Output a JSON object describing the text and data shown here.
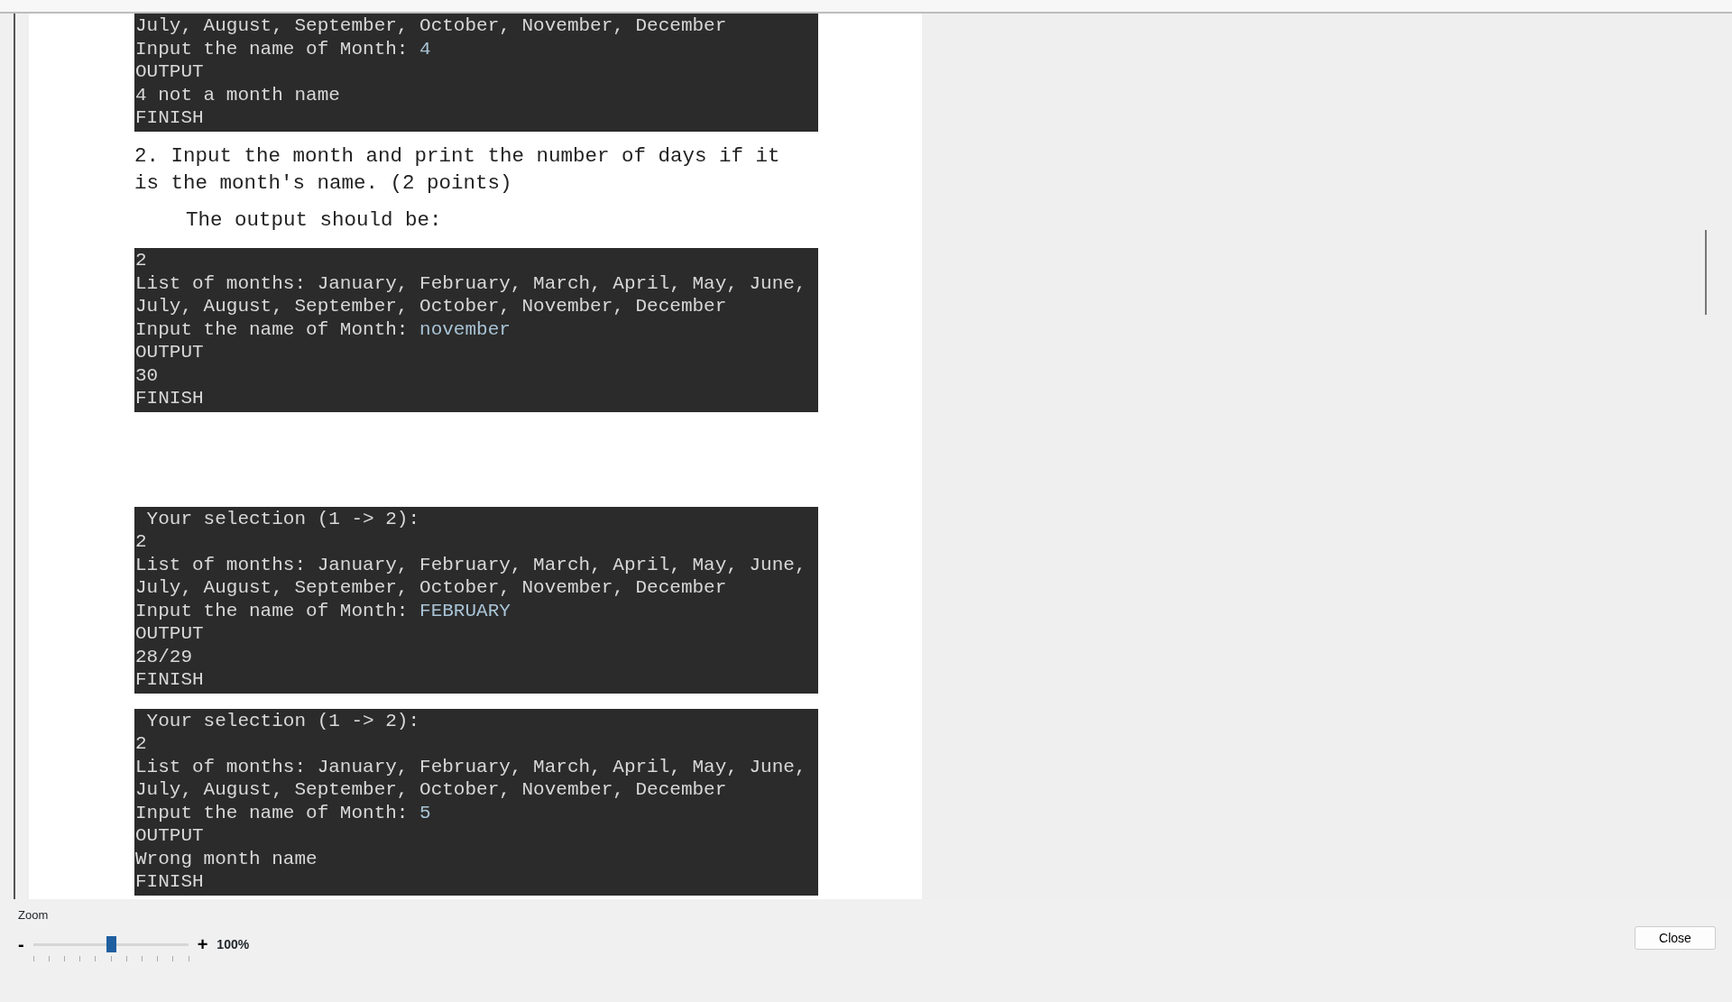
{
  "document": {
    "blocks": [
      {
        "kind": "console",
        "lines": [
          {
            "text": "July, August, September, October, November, December"
          },
          {
            "text": "Input the name of Month: ",
            "input": "4"
          },
          {
            "text": "OUTPUT"
          },
          {
            "text": "4 not a month name"
          },
          {
            "text": "FINISH"
          }
        ]
      },
      {
        "kind": "paragraph",
        "text": "2. Input the month and print the number of days if it is the month's name. (2 points)"
      },
      {
        "kind": "note",
        "text": "The output should be:"
      },
      {
        "kind": "console",
        "lines": [
          {
            "text": "2"
          },
          {
            "text": "List of months: January, February, March, April, May, June,"
          },
          {
            "text": "July, August, September, October, November, December"
          },
          {
            "text": "Input the name of Month: ",
            "input": "november"
          },
          {
            "text": "OUTPUT"
          },
          {
            "text": "30"
          },
          {
            "text": "FINISH"
          }
        ]
      },
      {
        "kind": "gap"
      },
      {
        "kind": "console",
        "lines": [
          {
            "text": " Your selection (1 -> 2):"
          },
          {
            "text": "2"
          },
          {
            "text": "List of months: January, February, March, April, May, June,"
          },
          {
            "text": "July, August, September, October, November, December"
          },
          {
            "text": "Input the name of Month: ",
            "input": "FEBRUARY"
          },
          {
            "text": "OUTPUT"
          },
          {
            "text": "28/29"
          },
          {
            "text": "FINISH"
          }
        ]
      },
      {
        "kind": "console",
        "lines": [
          {
            "text": " Your selection (1 -> 2):"
          },
          {
            "text": "2"
          },
          {
            "text": "List of months: January, February, March, April, May, June,"
          },
          {
            "text": "July, August, September, October, November, December"
          },
          {
            "text": "Input the name of Month: ",
            "input": "5"
          },
          {
            "text": "OUTPUT"
          },
          {
            "text": "Wrong month name"
          },
          {
            "text": "FINISH"
          }
        ]
      }
    ]
  },
  "zoom": {
    "label": "Zoom",
    "minus": "-",
    "plus": "+",
    "level": 0.5,
    "value": "100%"
  },
  "close_button": "Close"
}
